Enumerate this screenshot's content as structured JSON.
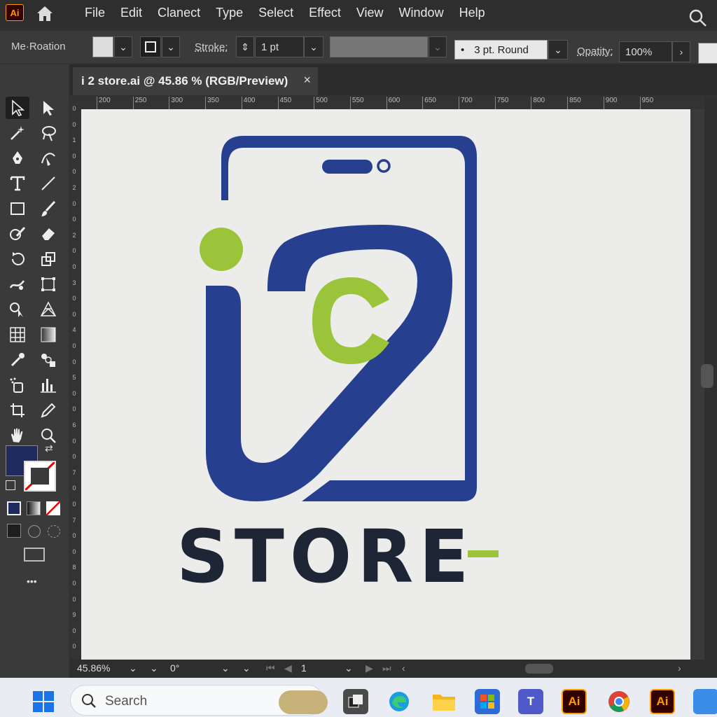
{
  "app": {
    "logo_text": "Ai"
  },
  "menu": {
    "items": [
      "File",
      "Edit",
      "Clanect",
      "Type",
      "Select",
      "Effect",
      "View",
      "Window",
      "Help"
    ]
  },
  "control_bar": {
    "selection_label": "Me·Roation",
    "stroke_label": "Stroke:",
    "stroke_value": "1 pt",
    "brush_value": "3 pt. Round",
    "opacity_label": "Opatity:",
    "opacity_value": "100%"
  },
  "document_tab": {
    "title": "i 2 store.ai @ 45.86 % (RGB/Preview)",
    "close_glyph": "×"
  },
  "ruler": {
    "top_ticks": [
      "200",
      "250",
      "300",
      "350",
      "400",
      "450",
      "500",
      "550",
      "600",
      "650",
      "700",
      "750",
      "800",
      "850",
      "900",
      "950"
    ],
    "left_ticks": [
      "0",
      "0",
      "1",
      "0",
      "0",
      "2",
      "0",
      "0",
      "2",
      "0",
      "0",
      "3",
      "0",
      "0",
      "4",
      "0",
      "0",
      "5",
      "0",
      "0",
      "6",
      "0",
      "0",
      "7",
      "0",
      "0",
      "7",
      "0",
      "0",
      "8",
      "0",
      "0",
      "9",
      "0",
      "0"
    ]
  },
  "artwork": {
    "logo_wordmark": "STORE",
    "colors": {
      "navy": "#263f8f",
      "green": "#9bc43a",
      "dark_text": "#1e2535"
    }
  },
  "status_bar": {
    "zoom": "45.86%",
    "rotation": "0°",
    "artboard": "1"
  },
  "taskbar": {
    "search_placeholder": "Search",
    "ai_label_1": "Ai",
    "ai_label_2": "Ai"
  },
  "toolbar": {
    "more_glyph": "•••"
  }
}
